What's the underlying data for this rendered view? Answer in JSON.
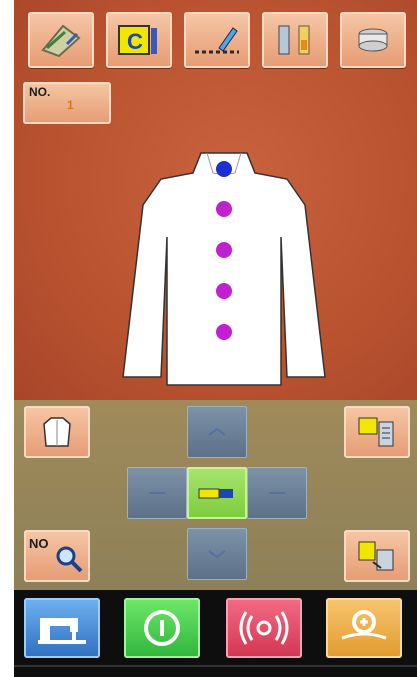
{
  "toolbar": {
    "buttons": [
      {
        "icon": "sewing-pattern-icon"
      },
      {
        "icon": "clipboard-c-icon",
        "text": "C"
      },
      {
        "icon": "stitch-edit-icon"
      },
      {
        "icon": "thread-tension-icon"
      },
      {
        "icon": "bobbin-wind-icon"
      }
    ]
  },
  "pattern_no": {
    "label": "NO.",
    "value": "1"
  },
  "garment": {
    "icon": "shirt-icon",
    "buttons": 5
  },
  "control_panel": {
    "left_top_icon": "shirt-select-icon",
    "left_bottom": {
      "text": "NO",
      "icon": "search-icon"
    },
    "right_top_icon": "list-settings-icon",
    "right_bottom_icon": "copy-pattern-icon",
    "center_icon": "jog-toggle-icon"
  },
  "bottom_bar": [
    {
      "icon": "sewing-machine-icon",
      "color": "#2f6fc0"
    },
    {
      "icon": "info-icon",
      "color": "#2fb53b"
    },
    {
      "icon": "broadcast-icon",
      "color": "#d33552"
    },
    {
      "icon": "zoom-pattern-icon",
      "color": "#e29a2d"
    }
  ]
}
